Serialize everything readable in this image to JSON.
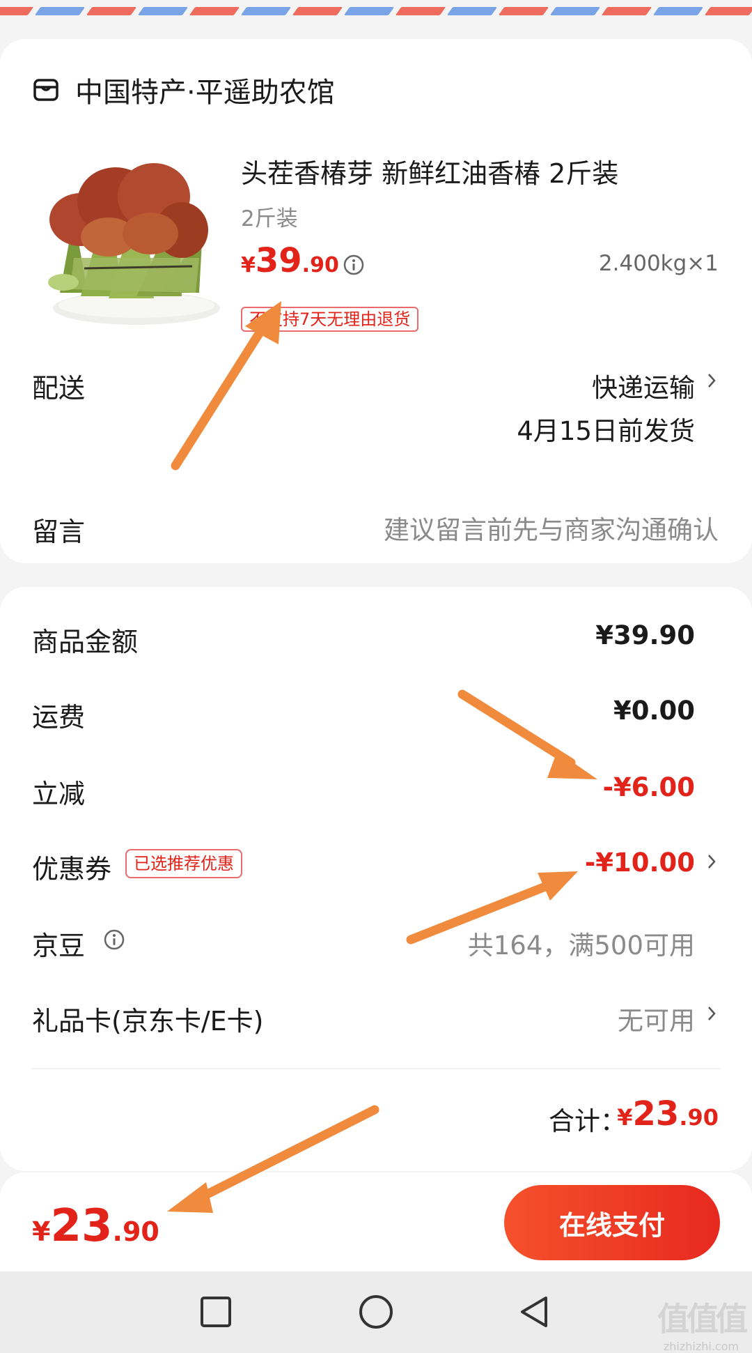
{
  "store": {
    "name": "中国特产·平遥助农馆",
    "icon": "store-icon"
  },
  "product": {
    "title": "头茬香椿芽 新鲜红油香椿 2斤装",
    "spec": "2斤装",
    "price_currency": "¥",
    "price_int": "39",
    "price_dec": ".90",
    "weight_qty": "2.400kg×1",
    "return_tag": "不支持7天无理由退货",
    "image": "toon-sprouts-photo"
  },
  "delivery": {
    "label": "配送",
    "method": "快递运输",
    "ship_date": "4月15日前发货"
  },
  "message": {
    "label": "留言",
    "placeholder": "建议留言前先与商家沟通确认"
  },
  "summary": {
    "goods_label": "商品金额",
    "goods_value": "¥39.90",
    "shipping_label": "运费",
    "shipping_value": "¥0.00",
    "discount_label": "立减",
    "discount_value": "-¥6.00",
    "coupon_label": "优惠券",
    "coupon_tag": "已选推荐优惠",
    "coupon_value": "-¥10.00",
    "jingdou_label": "京豆",
    "jingdou_value": "共164，满500可用",
    "giftcard_label": "礼品卡(京东卡/E卡)",
    "giftcard_value": "无可用",
    "total_label": "合计：",
    "total_currency": "¥",
    "total_int": "23",
    "total_dec": ".90"
  },
  "footer": {
    "price_currency": "¥",
    "price_int": "23",
    "price_dec": ".90",
    "pay_label": "在线支付"
  },
  "watermark": {
    "big": "值值值",
    "small": "zhizhizhi.com"
  },
  "colors": {
    "accent": "#e2231a",
    "annotation_arrow": "#f08a3c",
    "pay_gradient_start": "#f5512b",
    "pay_gradient_end": "#e7291f"
  }
}
